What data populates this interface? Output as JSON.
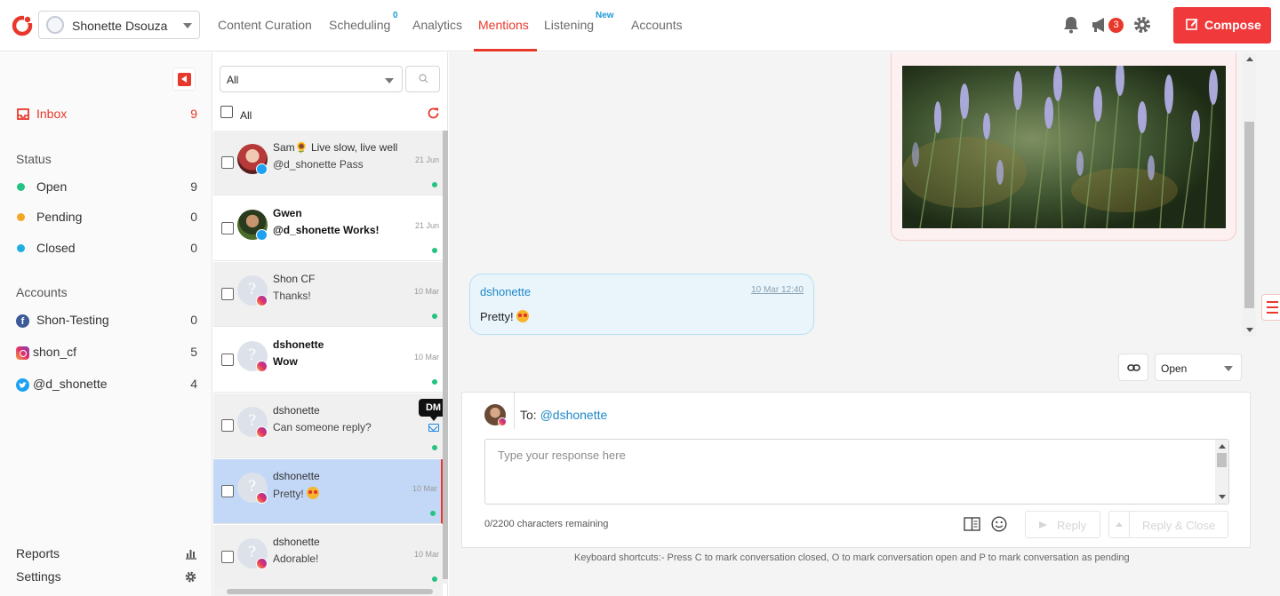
{
  "app": {
    "account_name": "Shonette Dsouza",
    "nav": [
      {
        "label": "Content Curation"
      },
      {
        "label": "Scheduling",
        "sup": "0"
      },
      {
        "label": "Analytics"
      },
      {
        "label": "Mentions",
        "active": true
      },
      {
        "label": "Listening",
        "sup": "New"
      },
      {
        "label": "Accounts"
      }
    ],
    "notification_badge": "3",
    "compose_label": "Compose",
    "accent_color": "#e8382b"
  },
  "sidebar": {
    "inbox": {
      "label": "Inbox",
      "count": "9"
    },
    "status_heading": "Status",
    "status": [
      {
        "label": "Open",
        "count": "9",
        "color": "#26c281"
      },
      {
        "label": "Pending",
        "count": "0",
        "color": "#f5a623"
      },
      {
        "label": "Closed",
        "count": "0",
        "color": "#1eaee0"
      }
    ],
    "accounts_heading": "Accounts",
    "accounts": [
      {
        "label": "Shon-Testing",
        "count": "0",
        "network": "facebook"
      },
      {
        "label": "shon_cf",
        "count": "5",
        "network": "instagram"
      },
      {
        "label": "@d_shonette",
        "count": "4",
        "network": "twitter"
      }
    ],
    "reports_label": "Reports",
    "settings_label": "Settings"
  },
  "list": {
    "filter_value": "All",
    "select_all_label": "All",
    "dm_badge": "DM",
    "conversations": [
      {
        "name": "Sam🌻 Live slow, live well",
        "message": "@d_shonette Pass",
        "date": "21 Jun",
        "network": "twitter",
        "unread": false
      },
      {
        "name": "Gwen",
        "message": "@d_shonette Works!",
        "date": "21 Jun",
        "network": "twitter",
        "unread": true
      },
      {
        "name": "Shon CF",
        "message": "Thanks!",
        "date": "10 Mar",
        "network": "instagram",
        "unread": false
      },
      {
        "name": "dshonette",
        "message": "Wow",
        "date": "10 Mar",
        "network": "instagram",
        "unread": true
      },
      {
        "name": "dshonette",
        "message": "Can someone reply?",
        "date": "",
        "network": "instagram",
        "unread": false
      },
      {
        "name": "dshonette",
        "message": "Pretty!",
        "date": "10 Mar",
        "network": "instagram",
        "unread": false,
        "selected": true
      },
      {
        "name": "dshonette",
        "message": "Adorable!",
        "date": "10 Mar",
        "network": "instagram",
        "unread": false
      }
    ]
  },
  "thread": {
    "message": {
      "from": "dshonette",
      "timestamp": "10 Mar 12:40",
      "text": "Pretty!"
    },
    "status_value": "Open"
  },
  "composer": {
    "to_prefix": "To:",
    "to_handle": "@dshonette",
    "placeholder": "Type your response here",
    "chars_remaining": "0/2200 characters remaining",
    "reply_label": "Reply",
    "reply_close_label": "Reply & Close",
    "shortcuts_text": "Keyboard shortcuts:- Press C to mark conversation closed, O to mark conversation open and P to mark conversation as pending"
  }
}
